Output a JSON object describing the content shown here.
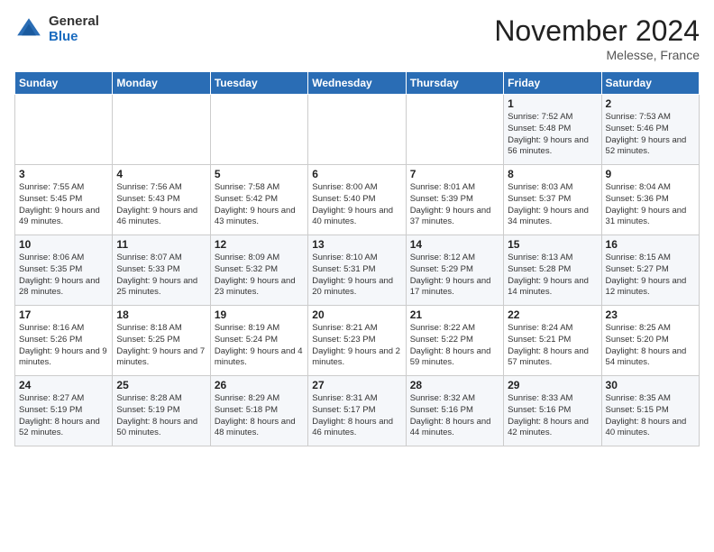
{
  "header": {
    "logo_general": "General",
    "logo_blue": "Blue",
    "title": "November 2024",
    "location": "Melesse, France"
  },
  "days_of_week": [
    "Sunday",
    "Monday",
    "Tuesday",
    "Wednesday",
    "Thursday",
    "Friday",
    "Saturday"
  ],
  "weeks": [
    [
      {
        "day": "",
        "info": ""
      },
      {
        "day": "",
        "info": ""
      },
      {
        "day": "",
        "info": ""
      },
      {
        "day": "",
        "info": ""
      },
      {
        "day": "",
        "info": ""
      },
      {
        "day": "1",
        "info": "Sunrise: 7:52 AM\nSunset: 5:48 PM\nDaylight: 9 hours and 56 minutes."
      },
      {
        "day": "2",
        "info": "Sunrise: 7:53 AM\nSunset: 5:46 PM\nDaylight: 9 hours and 52 minutes."
      }
    ],
    [
      {
        "day": "3",
        "info": "Sunrise: 7:55 AM\nSunset: 5:45 PM\nDaylight: 9 hours and 49 minutes."
      },
      {
        "day": "4",
        "info": "Sunrise: 7:56 AM\nSunset: 5:43 PM\nDaylight: 9 hours and 46 minutes."
      },
      {
        "day": "5",
        "info": "Sunrise: 7:58 AM\nSunset: 5:42 PM\nDaylight: 9 hours and 43 minutes."
      },
      {
        "day": "6",
        "info": "Sunrise: 8:00 AM\nSunset: 5:40 PM\nDaylight: 9 hours and 40 minutes."
      },
      {
        "day": "7",
        "info": "Sunrise: 8:01 AM\nSunset: 5:39 PM\nDaylight: 9 hours and 37 minutes."
      },
      {
        "day": "8",
        "info": "Sunrise: 8:03 AM\nSunset: 5:37 PM\nDaylight: 9 hours and 34 minutes."
      },
      {
        "day": "9",
        "info": "Sunrise: 8:04 AM\nSunset: 5:36 PM\nDaylight: 9 hours and 31 minutes."
      }
    ],
    [
      {
        "day": "10",
        "info": "Sunrise: 8:06 AM\nSunset: 5:35 PM\nDaylight: 9 hours and 28 minutes."
      },
      {
        "day": "11",
        "info": "Sunrise: 8:07 AM\nSunset: 5:33 PM\nDaylight: 9 hours and 25 minutes."
      },
      {
        "day": "12",
        "info": "Sunrise: 8:09 AM\nSunset: 5:32 PM\nDaylight: 9 hours and 23 minutes."
      },
      {
        "day": "13",
        "info": "Sunrise: 8:10 AM\nSunset: 5:31 PM\nDaylight: 9 hours and 20 minutes."
      },
      {
        "day": "14",
        "info": "Sunrise: 8:12 AM\nSunset: 5:29 PM\nDaylight: 9 hours and 17 minutes."
      },
      {
        "day": "15",
        "info": "Sunrise: 8:13 AM\nSunset: 5:28 PM\nDaylight: 9 hours and 14 minutes."
      },
      {
        "day": "16",
        "info": "Sunrise: 8:15 AM\nSunset: 5:27 PM\nDaylight: 9 hours and 12 minutes."
      }
    ],
    [
      {
        "day": "17",
        "info": "Sunrise: 8:16 AM\nSunset: 5:26 PM\nDaylight: 9 hours and 9 minutes."
      },
      {
        "day": "18",
        "info": "Sunrise: 8:18 AM\nSunset: 5:25 PM\nDaylight: 9 hours and 7 minutes."
      },
      {
        "day": "19",
        "info": "Sunrise: 8:19 AM\nSunset: 5:24 PM\nDaylight: 9 hours and 4 minutes."
      },
      {
        "day": "20",
        "info": "Sunrise: 8:21 AM\nSunset: 5:23 PM\nDaylight: 9 hours and 2 minutes."
      },
      {
        "day": "21",
        "info": "Sunrise: 8:22 AM\nSunset: 5:22 PM\nDaylight: 8 hours and 59 minutes."
      },
      {
        "day": "22",
        "info": "Sunrise: 8:24 AM\nSunset: 5:21 PM\nDaylight: 8 hours and 57 minutes."
      },
      {
        "day": "23",
        "info": "Sunrise: 8:25 AM\nSunset: 5:20 PM\nDaylight: 8 hours and 54 minutes."
      }
    ],
    [
      {
        "day": "24",
        "info": "Sunrise: 8:27 AM\nSunset: 5:19 PM\nDaylight: 8 hours and 52 minutes."
      },
      {
        "day": "25",
        "info": "Sunrise: 8:28 AM\nSunset: 5:19 PM\nDaylight: 8 hours and 50 minutes."
      },
      {
        "day": "26",
        "info": "Sunrise: 8:29 AM\nSunset: 5:18 PM\nDaylight: 8 hours and 48 minutes."
      },
      {
        "day": "27",
        "info": "Sunrise: 8:31 AM\nSunset: 5:17 PM\nDaylight: 8 hours and 46 minutes."
      },
      {
        "day": "28",
        "info": "Sunrise: 8:32 AM\nSunset: 5:16 PM\nDaylight: 8 hours and 44 minutes."
      },
      {
        "day": "29",
        "info": "Sunrise: 8:33 AM\nSunset: 5:16 PM\nDaylight: 8 hours and 42 minutes."
      },
      {
        "day": "30",
        "info": "Sunrise: 8:35 AM\nSunset: 5:15 PM\nDaylight: 8 hours and 40 minutes."
      }
    ]
  ]
}
